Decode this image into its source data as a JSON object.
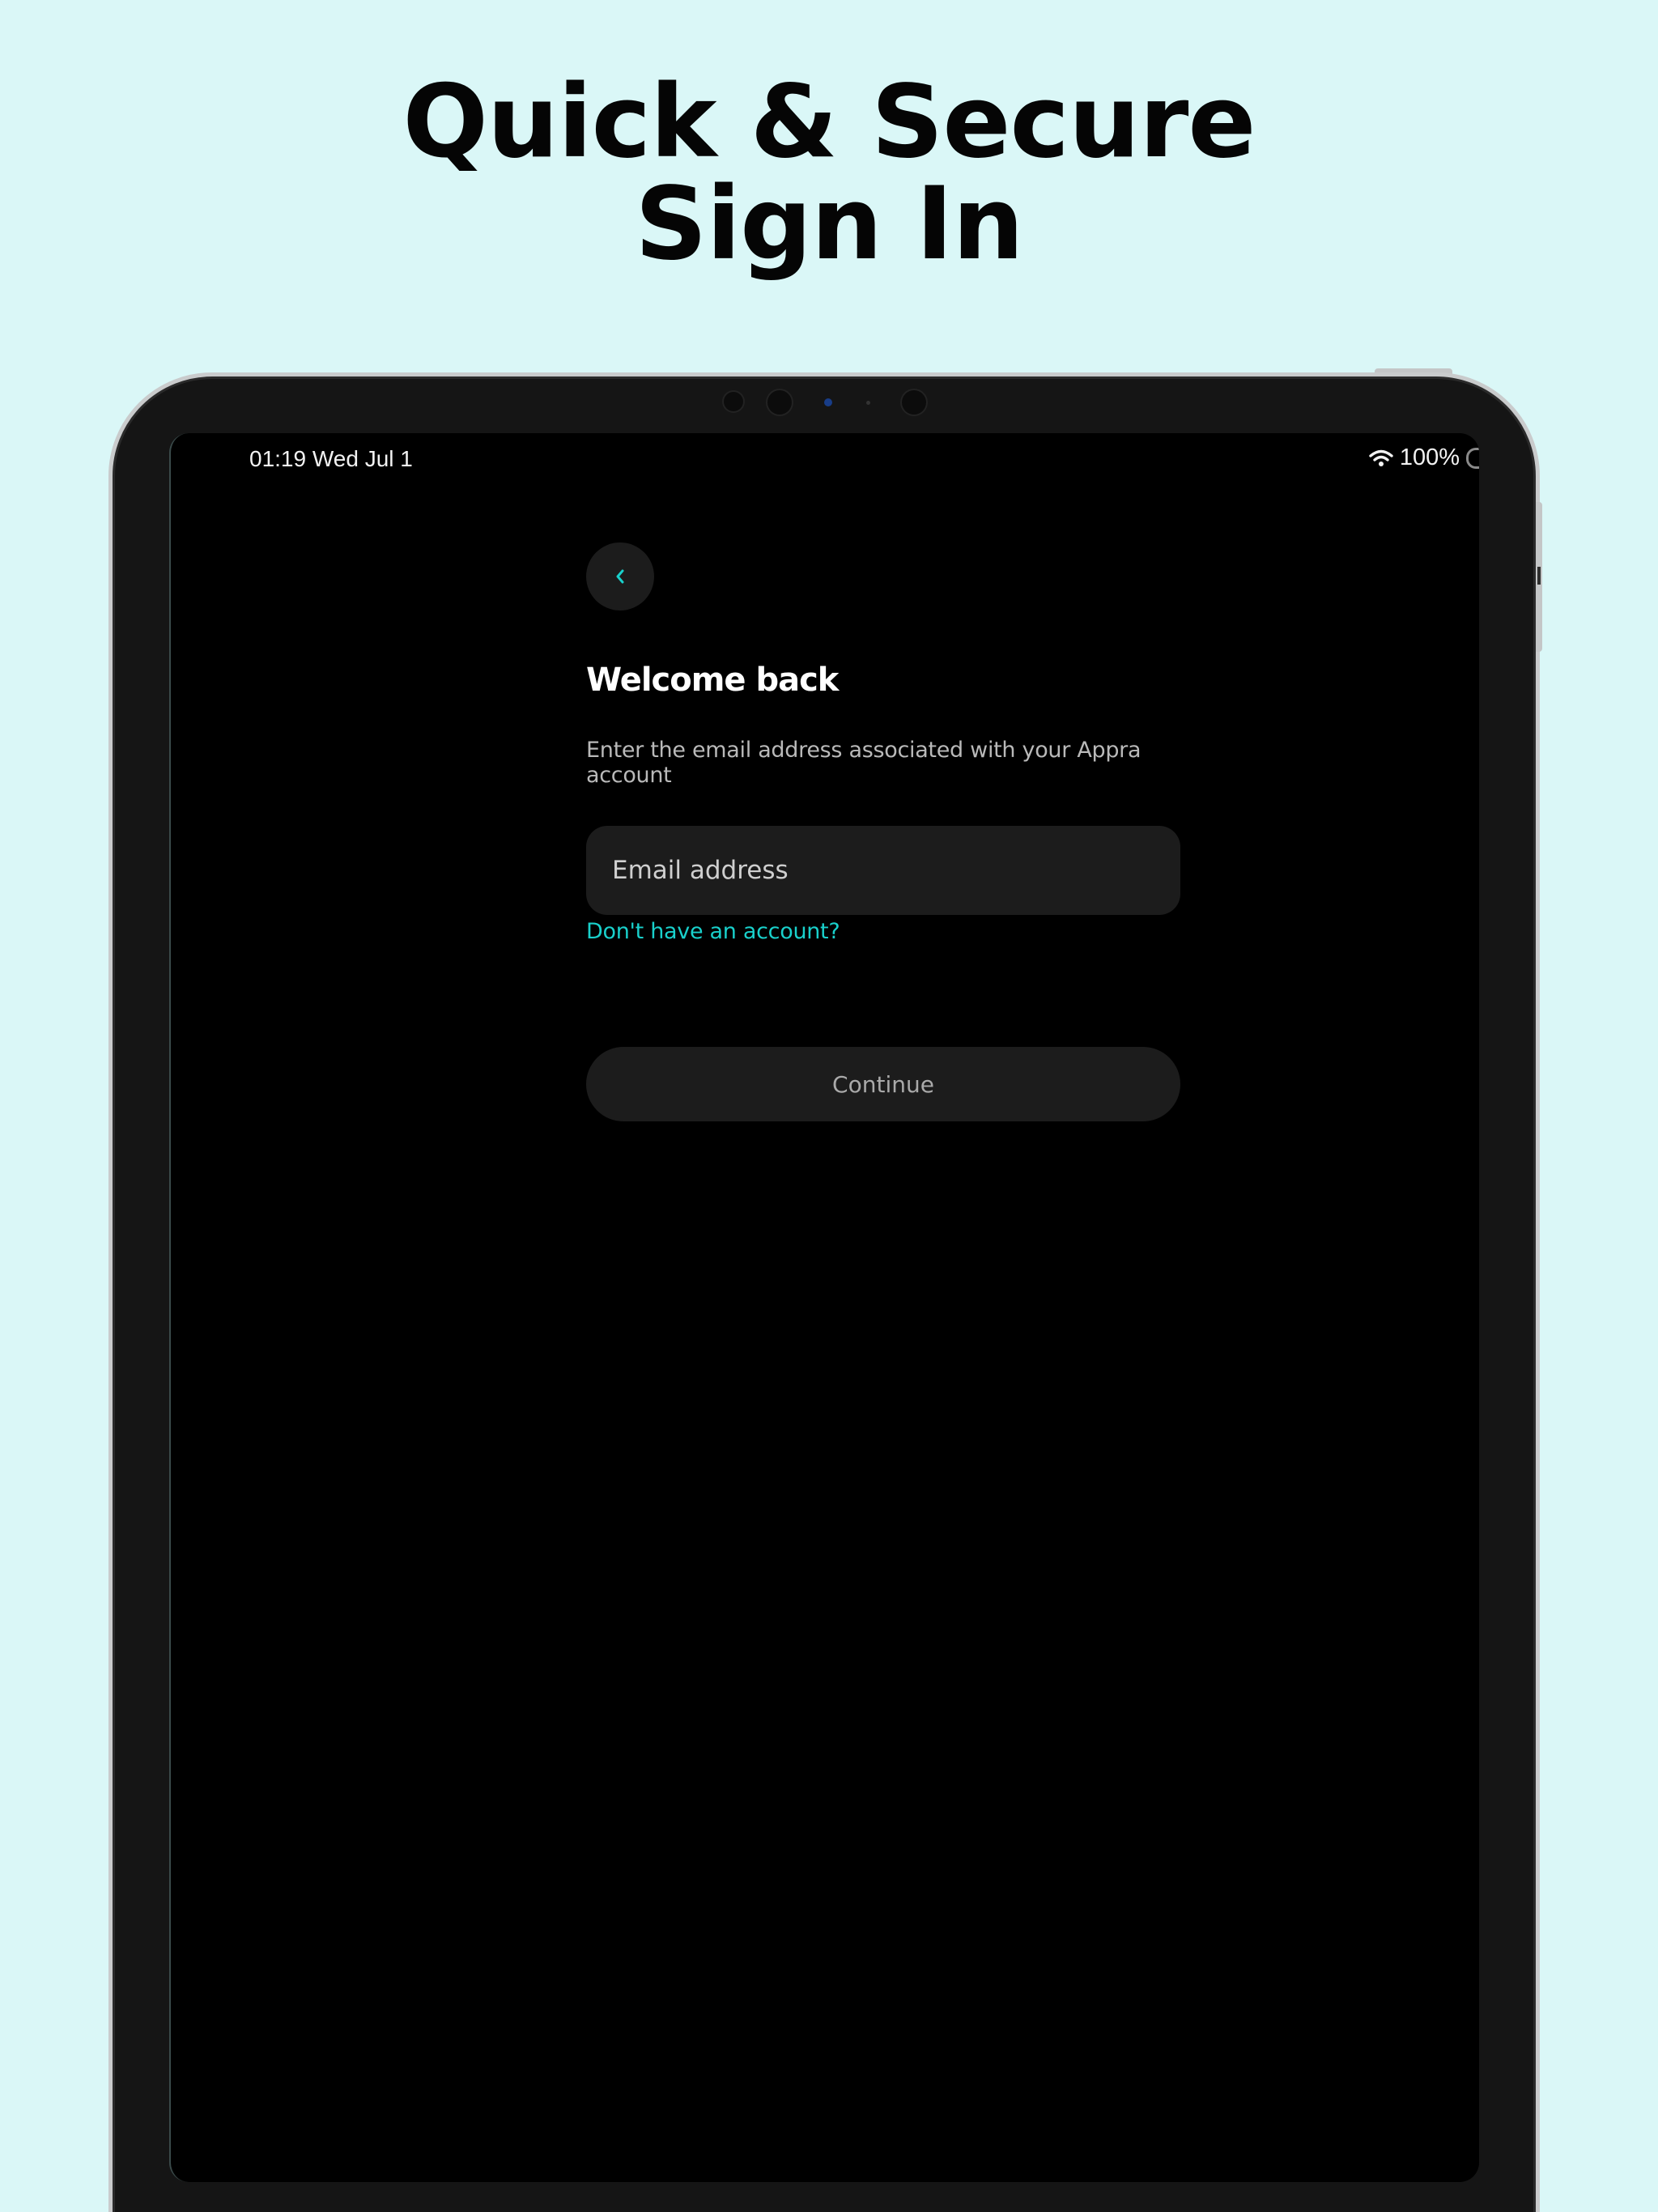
{
  "headline": {
    "line1": "Quick & Secure",
    "line2": "Sign In"
  },
  "status_bar": {
    "time_date": "01:19   Wed Jul 1",
    "battery": "100%",
    "wifi_icon": "wifi-icon",
    "battery_icon": "battery-icon"
  },
  "signin": {
    "back_icon": "chevron-left-icon",
    "title": "Welcome back",
    "subtitle": "Enter the email address associated with your Appra account",
    "email_placeholder": "Email address",
    "email_value": "",
    "no_account_link": "Don't have an account?",
    "continue_label": "Continue"
  },
  "colors": {
    "background": "#daf7f7",
    "screen": "#000000",
    "accent": "#19d0cb",
    "field": "#1c1c1c"
  }
}
